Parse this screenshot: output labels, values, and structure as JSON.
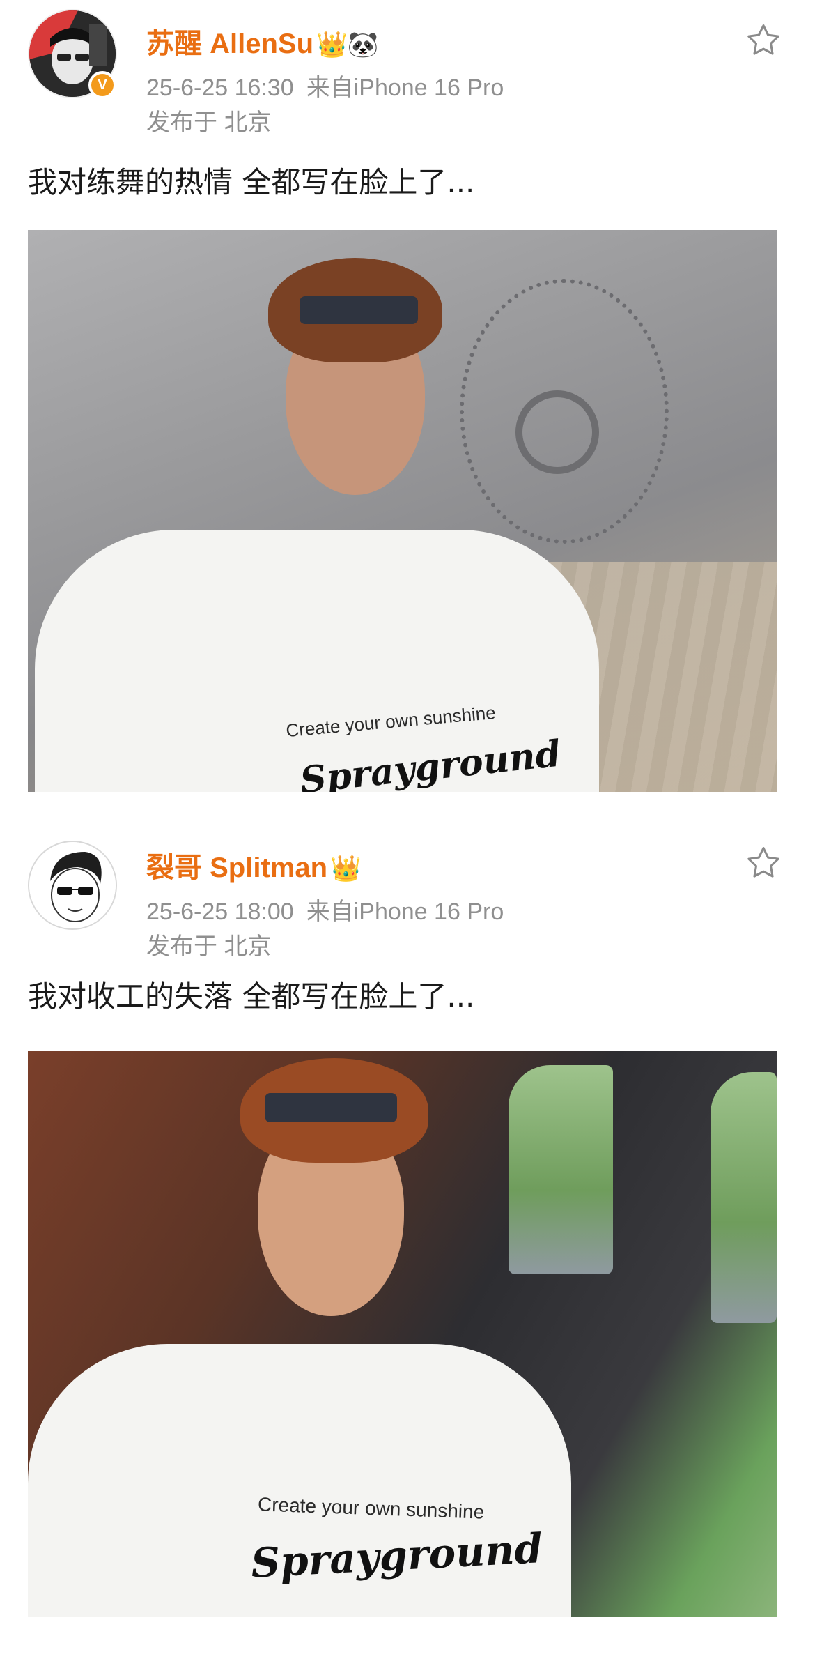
{
  "posts": [
    {
      "username": "苏醒 AllenSu",
      "badges": "👑🐼",
      "verified_mark": "V",
      "time": "25-6-25 16:30",
      "source": "来自iPhone 16 Pro",
      "location": "发布于 北京",
      "caption": "我对练舞的热情 全都写在脸上了...",
      "shirt_text": "Create your own sunshine",
      "shirt_logo": "Sprayground"
    },
    {
      "username": "裂哥 Splitman",
      "badges": "👑",
      "time": "25-6-25 18:00",
      "source": "来自iPhone 16 Pro",
      "location": "发布于 北京",
      "caption": "我对收工的失落 全都写在脸上了...",
      "shirt_text": "Create your own sunshine",
      "shirt_logo": "Sprayground"
    }
  ],
  "icons": {
    "star": "star-outline-icon"
  },
  "colors": {
    "username": "#e96e12",
    "meta": "#8f8f8f",
    "caption": "#1a1a1a",
    "verified": "#f39a1b"
  }
}
